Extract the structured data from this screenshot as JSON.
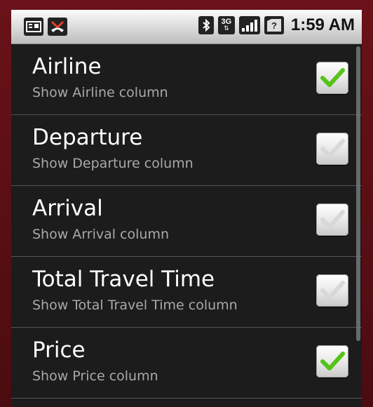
{
  "status_bar": {
    "time": "1:59 AM",
    "network_type": "3G",
    "left_icons": [
      "keyboard-notification-icon",
      "missed-call-icon"
    ],
    "right_icons": [
      "bluetooth-icon",
      "network-3g-icon",
      "signal-strength-icon",
      "sim-unknown-icon"
    ]
  },
  "preferences": [
    {
      "title": "Airline",
      "summary": "Show Airline column",
      "checked": true
    },
    {
      "title": "Departure",
      "summary": "Show Departure column",
      "checked": false
    },
    {
      "title": "Arrival",
      "summary": "Show Arrival column",
      "checked": false
    },
    {
      "title": "Total Travel Time",
      "summary": "Show Total Travel Time column",
      "checked": false
    },
    {
      "title": "Price",
      "summary": "Show Price column",
      "checked": true
    }
  ],
  "colors": {
    "check_on": "#55c318",
    "check_off": "#d8d8d8",
    "background": "#1c1c1c",
    "frame": "#5a0f14"
  }
}
